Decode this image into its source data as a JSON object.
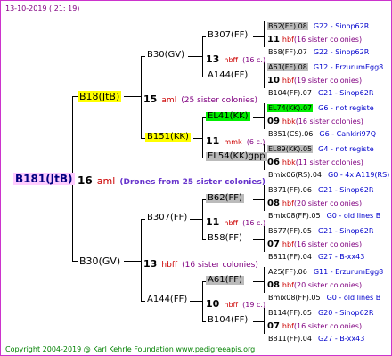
{
  "timestamp": "13-10-2019 ( 21: 19)",
  "footer": "Copyright 2004-2019 @ Karl Kehrle Foundation   www.pedigreeapis.org",
  "root": {
    "label": "B181(JtB)",
    "num": "16",
    "unit": "aml",
    "note": "(Drones from 25 sister colonies)"
  },
  "gen1": [
    {
      "label": "B18(JtB)",
      "num": "15",
      "unit": "aml",
      "note": "(25 sister colonies)"
    },
    {
      "label": "B30(GV)",
      "num": "13",
      "unit": "hbff",
      "note": "(16 sister colonies)"
    }
  ],
  "gen2": [
    {
      "label": "B30(GV)",
      "num": "13",
      "unit": "hbff",
      "note": "(16 c.)"
    },
    {
      "label": "A144(FF)"
    },
    {
      "label": "B151(KK)",
      "num": "11",
      "unit": "mmk",
      "note": "(6 c.)"
    },
    {
      "label": "EL54(KK)gpp"
    },
    {
      "label": "B307(FF)",
      "num": "11",
      "unit": "hbff",
      "note": "(16 c.)"
    },
    {
      "label": "B58(FF)"
    },
    {
      "label": "A144(FF)",
      "num": "10",
      "unit": "hbff",
      "note": "(19 c.)"
    },
    {
      "label": "B104(FF)"
    }
  ],
  "gen3": [
    {
      "label": "B307(FF)",
      "num": "13",
      "unit": "hbff",
      "note": "(16 c.)"
    },
    {
      "label": "A144(FF)"
    },
    {
      "label": "EL41(KK)"
    },
    {
      "label": "EL54(KK)gpp"
    },
    {
      "label": "B62(FF)"
    },
    {
      "label": "B58(FF)"
    },
    {
      "label": "A61(FF)"
    },
    {
      "label": "B104(FF)"
    }
  ],
  "gen3_midnum": [
    {
      "num": "13",
      "unit": "hbff",
      "note": "(16 c.)"
    },
    {
      "num": "11",
      "unit": "mmk",
      "note": "(6 c.)"
    },
    {
      "num": "11",
      "unit": "hbff",
      "note": "(16 c.)"
    },
    {
      "num": "10",
      "unit": "hbff",
      "note": "(19 c.)"
    }
  ],
  "leaves": [
    {
      "label": "B62(FF).08",
      "code": "G22 - Sinop62R"
    },
    {
      "num": "11",
      "unit": "hbf",
      "note": "(16 sister colonies)"
    },
    {
      "label": "B58(FF).07",
      "code": "G22 - Sinop62R"
    },
    {
      "label": "A61(FF).08",
      "code": "G12 - ErzurumEgg8"
    },
    {
      "num": "10",
      "unit": "hbf",
      "note": "(19 sister colonies)"
    },
    {
      "label": "B104(FF).07",
      "code": "G21 - Sinop62R"
    },
    {
      "label": "EL74(KK).07",
      "code": "G6 - not registe"
    },
    {
      "num": "09",
      "unit": "hbk",
      "note": "(16 sister colonies)"
    },
    {
      "label": "B351(CS).06",
      "code": "G6 - Cankiri97Q"
    },
    {
      "label": "EL89(KK).05",
      "code": "G4 - not registe"
    },
    {
      "num": "06",
      "unit": "hbk",
      "note": "(11 sister colonies)"
    },
    {
      "label": "Bmix06(RS).04",
      "code": "G0 - 4x A119(RS)"
    },
    {
      "label": "B371(FF).06",
      "code": "G21 - Sinop62R"
    },
    {
      "num": "08",
      "unit": "hbf",
      "note": "(20 sister colonies)"
    },
    {
      "label": "Bmix08(FF).05",
      "code": "G0 - old lines B"
    },
    {
      "label": "B677(FF).05",
      "code": "G21 - Sinop62R"
    },
    {
      "num": "07",
      "unit": "hbf",
      "note": "(16 sister colonies)"
    },
    {
      "label": "B811(FF).04",
      "code": "G27 - B-xx43"
    },
    {
      "label": "A25(FF).06",
      "code": "G11 - ErzurumEgg8"
    },
    {
      "num": "08",
      "unit": "hbf",
      "note": "(20 sister colonies)"
    },
    {
      "label": "Bmix08(FF).05",
      "code": "G0 - old lines B"
    },
    {
      "label": "B114(FF).05",
      "code": "G20 - Sinop62R"
    },
    {
      "num": "07",
      "unit": "hbf",
      "note": "(16 sister colonies)"
    },
    {
      "label": "B811(FF).04",
      "code": "G27 - B-xx43"
    }
  ],
  "colors": {
    "border": "#cc33cc",
    "highlight": "#ffff00",
    "grey": "#bbbbbb",
    "green": "#00ee00",
    "code": "#0000cc",
    "unit": "#cc0000",
    "note": "#800080"
  }
}
